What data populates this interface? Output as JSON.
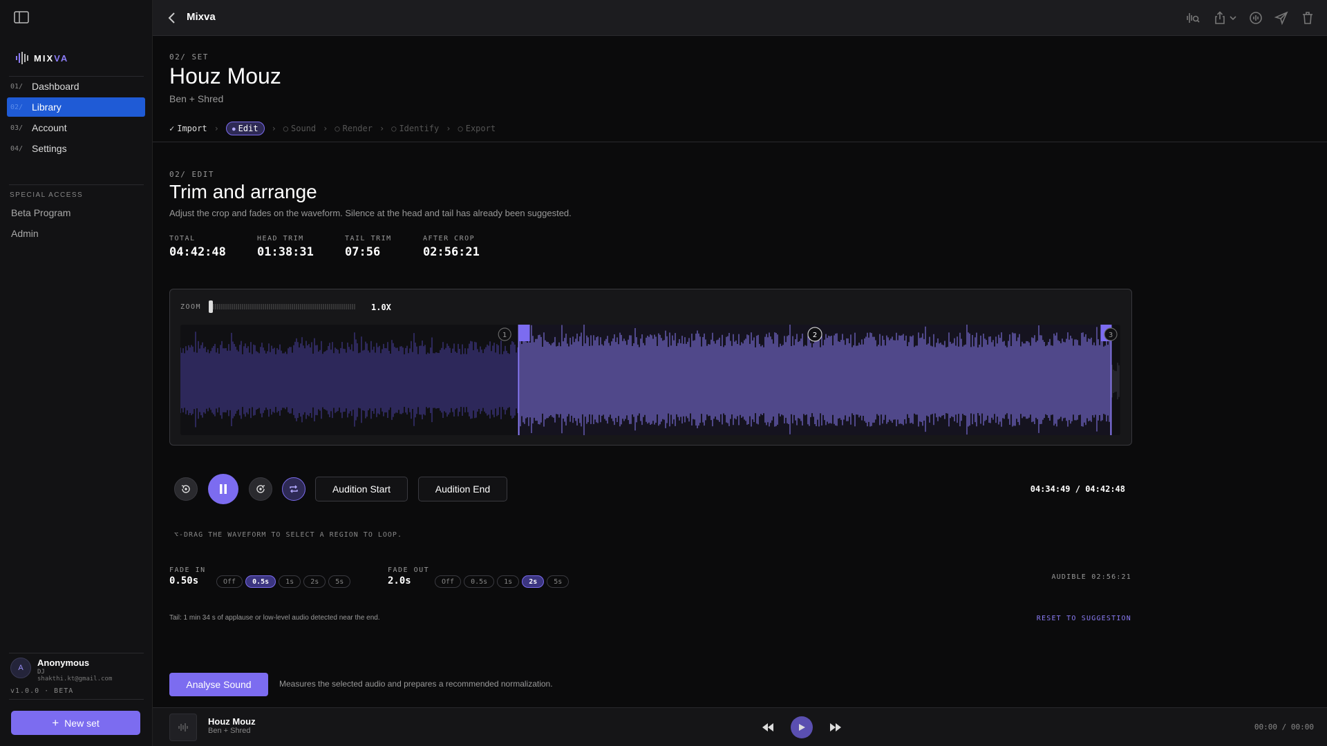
{
  "colors": {
    "accent": "#7c6cf0",
    "nav_active": "#1f5bd6",
    "wave_dim": "#4a3fa0",
    "wave_bright": "#8b7cf6"
  },
  "sidebar": {
    "logo": {
      "prefix": "MIX",
      "suffix": "VA"
    },
    "nav": [
      {
        "num": "01/",
        "label": "Dashboard"
      },
      {
        "num": "02/",
        "label": "Library"
      },
      {
        "num": "03/",
        "label": "Account"
      },
      {
        "num": "04/",
        "label": "Settings"
      }
    ],
    "special_title": "SPECIAL ACCESS",
    "special": [
      "Beta Program",
      "Admin"
    ],
    "user": {
      "initial": "A",
      "name": "Anonymous",
      "role": "DJ",
      "email": "shakthi.kt@gmail.com"
    },
    "version": "v1.0.0 · BETA",
    "new_set": "New set"
  },
  "topbar": {
    "title": "Mixva",
    "icons": [
      "waveform-search-icon",
      "share-icon",
      "chevron-down-icon",
      "audio-icon",
      "send-icon",
      "trash-icon"
    ]
  },
  "set": {
    "eyebrow": "02/ SET",
    "title": "Houz Mouz",
    "artist": "Ben + Shred"
  },
  "steps": [
    {
      "label": "Import",
      "state": "done",
      "mark": "✓"
    },
    {
      "label": "Edit",
      "state": "current",
      "mark": "●"
    },
    {
      "label": "Sound",
      "state": "todo",
      "mark": "○"
    },
    {
      "label": "Render",
      "state": "todo",
      "mark": "○"
    },
    {
      "label": "Identify",
      "state": "todo",
      "mark": "○"
    },
    {
      "label": "Export",
      "state": "todo",
      "mark": "○"
    }
  ],
  "edit": {
    "eyebrow": "02/ EDIT",
    "title": "Trim and arrange",
    "desc": "Adjust the crop and fades on the waveform. Silence at the head and tail has already been suggested."
  },
  "stats": [
    {
      "label": "TOTAL",
      "value": "04:42:48"
    },
    {
      "label": "HEAD TRIM",
      "value": "01:38:31"
    },
    {
      "label": "TAIL TRIM",
      "value": "07:56"
    },
    {
      "label": "AFTER CROP",
      "value": "02:56:21"
    }
  ],
  "waveform": {
    "zoom_label": "ZOOM",
    "zoom_value": "1.0X",
    "markers": [
      "1",
      "2",
      "3"
    ],
    "crop_start_frac": 0.36,
    "crop_end_frac": 0.99,
    "playhead_frac": 0.99
  },
  "transport": {
    "audition_start": "Audition Start",
    "audition_end": "Audition End",
    "time": "04:34:49 / 04:42:48",
    "hint": "⌥-DRAG THE WAVEFORM TO SELECT A REGION TO LOOP."
  },
  "fade_in": {
    "label": "FADE IN",
    "value": "0.50s",
    "options": [
      "Off",
      "0.5s",
      "1s",
      "2s",
      "5s"
    ],
    "selected": "0.5s"
  },
  "fade_out": {
    "label": "FADE OUT",
    "value": "2.0s",
    "options": [
      "Off",
      "0.5s",
      "1s",
      "2s",
      "5s"
    ],
    "selected": "2s"
  },
  "audible": "AUDIBLE 02:56:21",
  "tail_note": "Tail: 1 min 34 s of applause or low-level audio detected near the end.",
  "reset": "RESET TO SUGGESTION",
  "analyse": {
    "button": "Analyse Sound",
    "desc": "Measures the selected audio and prepares a recommended normalization."
  },
  "player": {
    "title": "Houz Mouz",
    "artist": "Ben + Shred",
    "time": "00:00 / 00:00"
  }
}
